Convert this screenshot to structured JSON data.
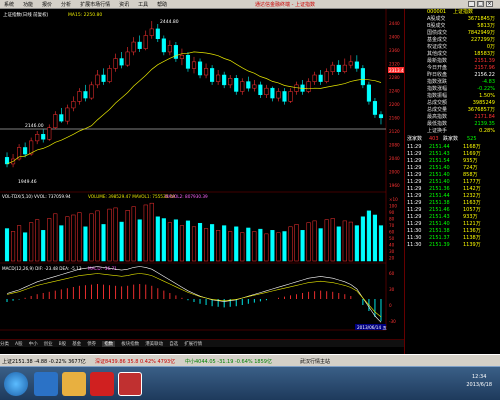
{
  "menu": {
    "items": [
      "系统",
      "功能",
      "报价",
      "分析",
      "扩展市场行情",
      "资讯",
      "工具",
      "帮助"
    ],
    "title": "通达信金融终端 - 上证指数"
  },
  "chart": {
    "header": "上证指数(日线 前复权)",
    "ma_label": "MA15: 2250.80",
    "high_label": "2444.80",
    "ref_label": "2146.00",
    "low_label": "1949.46",
    "vol_header": "VOL-TDX(5,10) VVOL: 737059.94",
    "vol_indicators": "VOLUME: 398529.47  MAVOL1: 755535.19",
    "vol_extra": "MAVOL2: 807930.39",
    "macd_header": "MACD(12,26,9) DIF: -23.48  DEA: -5.13",
    "macd_extra": "MACD: -36.71",
    "date_label": "2013/06/14 五",
    "price_ticks": [
      "2440",
      "2400",
      "2360",
      "2320",
      "2280",
      "2240",
      "2200",
      "2160",
      "2120",
      "2080",
      "2040",
      "2000",
      "1960"
    ],
    "vol_ticks": [
      "×10",
      "100",
      "90",
      "80",
      "70",
      "60",
      "50",
      "40",
      "30",
      "20"
    ],
    "macd_ticks": [
      "60",
      "30",
      "0",
      "-30"
    ],
    "last_price_tag": "2313.4",
    "colors": {
      "up": "#ff3232",
      "down": "#00ffff",
      "ma": "#e8e800",
      "ref": "#ffffff"
    },
    "axis_ticks_note": "",
    "candles": [
      [
        2030,
        2010,
        2045,
        2000,
        0
      ],
      [
        2010,
        2025,
        2040,
        2000,
        1
      ],
      [
        2025,
        2060,
        2070,
        2020,
        1
      ],
      [
        2060,
        2040,
        2075,
        2030,
        0
      ],
      [
        2040,
        2080,
        2090,
        2035,
        1
      ],
      [
        2080,
        2100,
        2110,
        2070,
        1
      ],
      [
        2100,
        2085,
        2115,
        2075,
        0
      ],
      [
        2085,
        2120,
        2130,
        2080,
        1
      ],
      [
        2120,
        2160,
        2170,
        2115,
        1
      ],
      [
        2160,
        2140,
        2180,
        2135,
        0
      ],
      [
        2140,
        2180,
        2190,
        2130,
        1
      ],
      [
        2180,
        2200,
        2215,
        2170,
        1
      ],
      [
        2200,
        2230,
        2240,
        2190,
        1
      ],
      [
        2230,
        2210,
        2250,
        2200,
        0
      ],
      [
        2210,
        2250,
        2260,
        2205,
        1
      ],
      [
        2250,
        2280,
        2295,
        2240,
        1
      ],
      [
        2280,
        2260,
        2300,
        2250,
        0
      ],
      [
        2260,
        2300,
        2310,
        2255,
        1
      ],
      [
        2300,
        2330,
        2345,
        2290,
        1
      ],
      [
        2330,
        2310,
        2350,
        2300,
        0
      ],
      [
        2310,
        2350,
        2365,
        2305,
        1
      ],
      [
        2350,
        2380,
        2395,
        2340,
        1
      ],
      [
        2380,
        2360,
        2400,
        2350,
        0
      ],
      [
        2360,
        2400,
        2415,
        2355,
        1
      ],
      [
        2400,
        2420,
        2444,
        2390,
        1
      ],
      [
        2420,
        2390,
        2435,
        2380,
        0
      ],
      [
        2390,
        2350,
        2400,
        2340,
        0
      ],
      [
        2350,
        2370,
        2385,
        2340,
        1
      ],
      [
        2370,
        2330,
        2380,
        2320,
        0
      ],
      [
        2330,
        2340,
        2360,
        2310,
        1
      ],
      [
        2340,
        2300,
        2350,
        2290,
        0
      ],
      [
        2300,
        2320,
        2335,
        2285,
        1
      ],
      [
        2320,
        2280,
        2330,
        2270,
        0
      ],
      [
        2280,
        2300,
        2315,
        2270,
        1
      ],
      [
        2300,
        2260,
        2310,
        2250,
        0
      ],
      [
        2260,
        2280,
        2295,
        2250,
        1
      ],
      [
        2280,
        2250,
        2290,
        2240,
        0
      ],
      [
        2250,
        2270,
        2280,
        2240,
        1
      ],
      [
        2270,
        2230,
        2280,
        2220,
        0
      ],
      [
        2230,
        2260,
        2270,
        2220,
        1
      ],
      [
        2260,
        2240,
        2275,
        2230,
        0
      ],
      [
        2240,
        2250,
        2265,
        2230,
        1
      ],
      [
        2250,
        2220,
        2260,
        2210,
        0
      ],
      [
        2220,
        2240,
        2250,
        2210,
        1
      ],
      [
        2240,
        2210,
        2245,
        2200,
        0
      ],
      [
        2210,
        2230,
        2240,
        2200,
        1
      ],
      [
        2230,
        2200,
        2240,
        2190,
        0
      ],
      [
        2200,
        2230,
        2240,
        2195,
        1
      ],
      [
        2230,
        2250,
        2260,
        2220,
        1
      ],
      [
        2250,
        2230,
        2265,
        2220,
        0
      ],
      [
        2230,
        2260,
        2270,
        2225,
        1
      ],
      [
        2260,
        2280,
        2290,
        2250,
        1
      ],
      [
        2280,
        2260,
        2295,
        2250,
        0
      ],
      [
        2260,
        2290,
        2300,
        2255,
        1
      ],
      [
        2290,
        2310,
        2320,
        2280,
        1
      ],
      [
        2310,
        2290,
        2325,
        2280,
        0
      ],
      [
        2290,
        2310,
        2330,
        2285,
        1
      ],
      [
        2310,
        2320,
        2340,
        2300,
        1
      ],
      [
        2320,
        2300,
        2340,
        2290,
        0
      ],
      [
        2300,
        2250,
        2310,
        2240,
        0
      ],
      [
        2250,
        2200,
        2260,
        2190,
        0
      ],
      [
        2200,
        2160,
        2210,
        2150,
        0
      ],
      [
        2160,
        2150,
        2170,
        2130,
        0
      ]
    ],
    "volumes": [
      55,
      50,
      60,
      48,
      65,
      70,
      52,
      72,
      80,
      60,
      75,
      78,
      82,
      58,
      80,
      85,
      62,
      88,
      90,
      66,
      86,
      92,
      70,
      95,
      98,
      75,
      72,
      65,
      70,
      60,
      68,
      58,
      64,
      55,
      62,
      52,
      60,
      50,
      58,
      48,
      56,
      50,
      54,
      46,
      52,
      48,
      50,
      58,
      62,
      52,
      65,
      68,
      55,
      70,
      72,
      58,
      68,
      66,
      60,
      75,
      85,
      78,
      60
    ],
    "macd": [
      -5,
      -3,
      -1,
      2,
      5,
      8,
      10,
      12,
      14,
      16,
      18,
      20,
      22,
      23,
      24,
      25,
      24,
      23,
      22,
      21,
      22,
      24,
      25,
      24,
      22,
      18,
      14,
      10,
      6,
      2,
      -2,
      -5,
      -8,
      -10,
      -12,
      -13,
      -14,
      -13,
      -12,
      -10,
      -8,
      -6,
      -4,
      -2,
      0,
      2,
      4,
      6,
      8,
      10,
      12,
      13,
      14,
      13,
      12,
      10,
      8,
      5,
      0,
      -10,
      -20,
      -30,
      -37
    ]
  },
  "quote": {
    "code": "000001",
    "name": "上证指数",
    "rows": [
      {
        "label": "A股成交",
        "value": "3671845万",
        "color": "#ffff00"
      },
      {
        "label": "B股成交",
        "value": "5813万",
        "color": "#ffff00"
      },
      {
        "label": "国债成交",
        "value": "7842949万",
        "color": "#ffff00"
      },
      {
        "label": "基金成交",
        "value": "227299万",
        "color": "#ffff00"
      },
      {
        "label": "权证成交",
        "value": "0万",
        "color": "#ffff00"
      },
      {
        "label": "其他成交",
        "value": "18583万",
        "color": "#ffff00"
      },
      {
        "label": "最新指数",
        "value": "2151.39",
        "color": "#ff3232"
      },
      {
        "label": "今日开盘",
        "value": "2157.96",
        "color": "#ff3232"
      },
      {
        "label": "昨日收盘",
        "value": "2156.22",
        "color": "#ffffff"
      },
      {
        "label": "指数涨跌",
        "value": "-4.83",
        "color": "#00ff00"
      },
      {
        "label": "指数涨幅",
        "value": "-0.22%",
        "color": "#00ff00"
      },
      {
        "label": "指数振幅",
        "value": "1.50%",
        "color": "#ffff00"
      },
      {
        "label": "总成交额",
        "value": "3985249",
        "color": "#ffff00"
      },
      {
        "label": "总成交量",
        "value": "3676857万",
        "color": "#ffff00"
      },
      {
        "label": "最高指数",
        "value": "2171.84",
        "color": "#ff3232"
      },
      {
        "label": "最低指数",
        "value": "2139.35",
        "color": "#00ff00"
      },
      {
        "label": "上证换手",
        "value": "0.28%",
        "color": "#ffff00"
      }
    ],
    "updown": {
      "up_label": "涨家数",
      "up": "403",
      "down_label": "跌家数",
      "down": "525"
    },
    "ticks": [
      {
        "time": "11:29",
        "price": "2151.44",
        "vol": "1168万"
      },
      {
        "time": "11:29",
        "price": "2151.43",
        "vol": "1169万"
      },
      {
        "time": "11:29",
        "price": "2151.54",
        "vol": "935万"
      },
      {
        "time": "11:29",
        "price": "2151.40",
        "vol": "724万"
      },
      {
        "time": "11:29",
        "price": "2151.40",
        "vol": "858万"
      },
      {
        "time": "11:29",
        "price": "2151.40",
        "vol": "1177万"
      },
      {
        "time": "11:29",
        "price": "2151.36",
        "vol": "1142万"
      },
      {
        "time": "11:29",
        "price": "2151.44",
        "vol": "1232万"
      },
      {
        "time": "11:29",
        "price": "2151.38",
        "vol": "1163万"
      },
      {
        "time": "11:29",
        "price": "2151.46",
        "vol": "1057万"
      },
      {
        "time": "11:29",
        "price": "2151.43",
        "vol": "933万"
      },
      {
        "time": "11:29",
        "price": "2151.40",
        "vol": "1121万"
      },
      {
        "time": "11:30",
        "price": "2151.38",
        "vol": "1136万"
      },
      {
        "time": "11:30",
        "price": "2151.37",
        "vol": "1138万"
      },
      {
        "time": "11:30",
        "price": "2151.39",
        "vol": "1139万"
      }
    ]
  },
  "tabs": [
    "分类",
    "A股",
    "中小",
    "创业",
    "B股",
    "基金",
    "债券",
    "指数",
    "板块指数",
    "港美联动",
    "自选",
    "扩展行情"
  ],
  "status": {
    "sh": "上证2151.38  -4.88  -0.22%  3677亿",
    "sz": "深证8439.86  35.8  0.42%  4793亿",
    "zxb": "中小4044.05  -31.19  -0.64%  1859亿",
    "conn": "武汉行情主站",
    "time": "12:34",
    "date": "2013/6/18"
  }
}
